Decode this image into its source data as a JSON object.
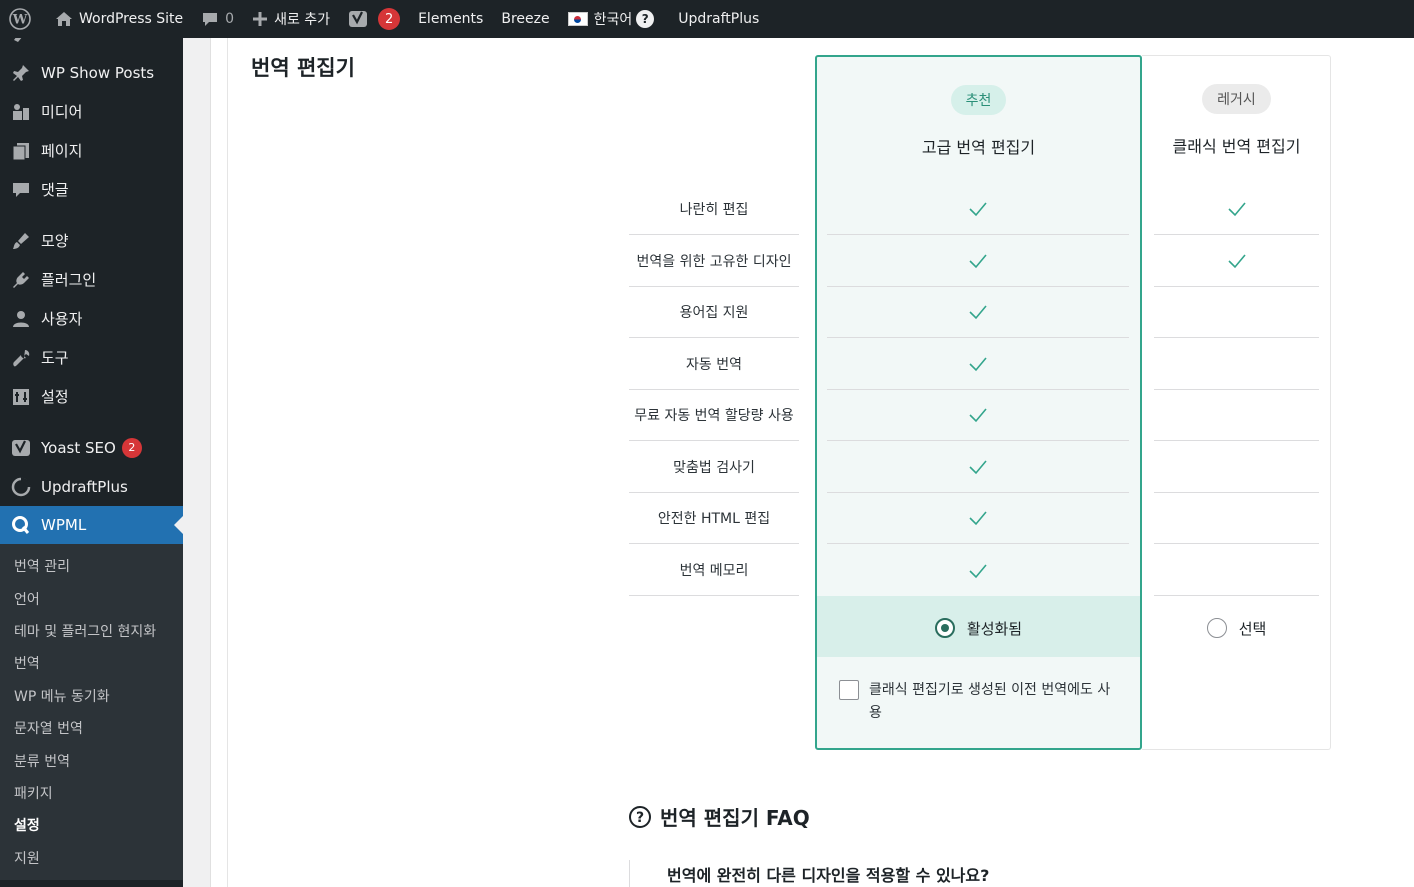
{
  "adminbar": {
    "site_name": "WordPress Site",
    "comments_count": "0",
    "new_label": "새로 추가",
    "yoast_badge": "2",
    "elements": "Elements",
    "breeze": "Breeze",
    "language": "한국어",
    "help": "?",
    "updraft": "UpdraftPlus"
  },
  "sidebar": {
    "partial_top": "ᅟ",
    "items": [
      {
        "label": "WP Show Posts",
        "icon": "pin-icon"
      },
      {
        "label": "미디어",
        "icon": "media-icon"
      },
      {
        "label": "페이지",
        "icon": "page-icon"
      },
      {
        "label": "댓글",
        "icon": "comment-icon"
      },
      {
        "label": "모양",
        "icon": "brush-icon"
      },
      {
        "label": "플러그인",
        "icon": "plugin-icon"
      },
      {
        "label": "사용자",
        "icon": "user-icon"
      },
      {
        "label": "도구",
        "icon": "wrench-icon"
      },
      {
        "label": "설정",
        "icon": "settings-icon"
      },
      {
        "label": "Yoast SEO",
        "icon": "yoast-icon",
        "badge": "2"
      },
      {
        "label": "UpdraftPlus",
        "icon": "updraft-icon"
      },
      {
        "label": "WPML",
        "icon": "wpml-icon"
      }
    ],
    "submenu": [
      "번역 관리",
      "언어",
      "테마 및 플러그인 현지화",
      "번역",
      "WP 메뉴 동기화",
      "문자열 번역",
      "분류 번역",
      "패키지",
      "설정",
      "지원"
    ]
  },
  "main": {
    "section_title": "번역 편집기",
    "recommended_pill": "추천",
    "legacy_pill": "레거시",
    "advanced_title": "고급 번역 편집기",
    "classic_title": "클래식 번역 편집기",
    "features": [
      {
        "label": "나란히 편집",
        "advanced": true,
        "classic": true
      },
      {
        "label": "번역을 위한 고유한 디자인",
        "advanced": true,
        "classic": true
      },
      {
        "label": "용어집 지원",
        "advanced": true,
        "classic": false
      },
      {
        "label": "자동 번역",
        "advanced": true,
        "classic": false
      },
      {
        "label": "무료 자동 번역 할당량 사용",
        "advanced": true,
        "classic": false
      },
      {
        "label": "맞춤법 검사기",
        "advanced": true,
        "classic": false
      },
      {
        "label": "안전한 HTML 편집",
        "advanced": true,
        "classic": false
      },
      {
        "label": "번역 메모리",
        "advanced": true,
        "classic": false
      }
    ],
    "activated_label": "활성화됨",
    "select_label": "선택",
    "checkbox_label": "클래식 편집기로 생성된 이전 번역에도 사용",
    "faq_title": "번역 편집기 FAQ",
    "faq_question": "번역에 완전히 다른 디자인을 적용할 수 있나요?"
  },
  "colors": {
    "accent_green": "#33a58c",
    "wp_blue": "#2271b1",
    "admin_dark": "#1d2327"
  }
}
